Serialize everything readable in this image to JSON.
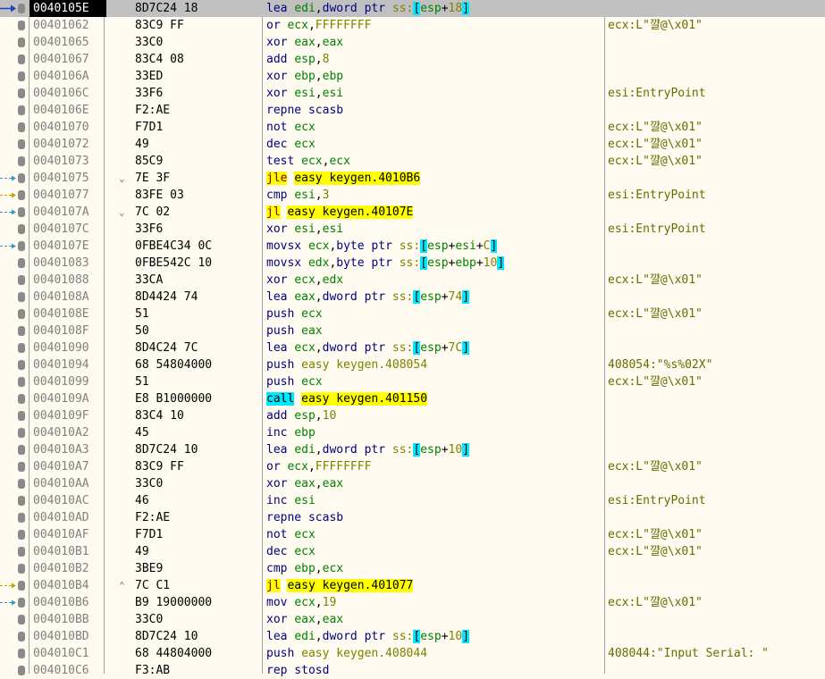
{
  "colors": {
    "background": "#fffbf0",
    "selected_row": "#c0c0c0",
    "address": "#808080",
    "mnemonic": "#000080",
    "register": "#008000",
    "number": "#808000",
    "jump_highlight": "#ffff00",
    "call_highlight": "#00e8ff",
    "comment": "#6b6b00",
    "jump_arrow": "#3399cc",
    "jump_arrow_dashed": "#c8a000"
  },
  "rows": [
    {
      "addr": "0040105E",
      "bytes": "8D7C24 18",
      "instr": [
        [
          "mn",
          "lea "
        ],
        [
          "reg",
          "edi"
        ],
        [
          "",
          ","
        ],
        [
          "kw",
          "dword ptr "
        ],
        [
          "seg",
          "ss:"
        ],
        [
          "br",
          "["
        ],
        [
          "reg",
          "esp"
        ],
        [
          "",
          "+"
        ],
        [
          "num",
          "18"
        ],
        [
          "br",
          "]"
        ]
      ],
      "comment": "",
      "selected": true,
      "arrow": "current"
    },
    {
      "addr": "00401062",
      "bytes": "83C9 FF",
      "instr": [
        [
          "mn",
          "or "
        ],
        [
          "reg",
          "ecx"
        ],
        [
          "",
          ","
        ],
        [
          "num",
          "FFFFFFFF"
        ]
      ],
      "comment": "ecx:L\"꺌@\\x01\""
    },
    {
      "addr": "00401065",
      "bytes": "33C0",
      "instr": [
        [
          "mn",
          "xor "
        ],
        [
          "reg",
          "eax"
        ],
        [
          "",
          ","
        ],
        [
          "reg",
          "eax"
        ]
      ],
      "comment": ""
    },
    {
      "addr": "00401067",
      "bytes": "83C4 08",
      "instr": [
        [
          "mn",
          "add "
        ],
        [
          "reg",
          "esp"
        ],
        [
          "",
          ","
        ],
        [
          "num",
          "8"
        ]
      ],
      "comment": ""
    },
    {
      "addr": "0040106A",
      "bytes": "33ED",
      "instr": [
        [
          "mn",
          "xor "
        ],
        [
          "reg",
          "ebp"
        ],
        [
          "",
          ","
        ],
        [
          "reg",
          "ebp"
        ]
      ],
      "comment": ""
    },
    {
      "addr": "0040106C",
      "bytes": "33F6",
      "instr": [
        [
          "mn",
          "xor "
        ],
        [
          "reg",
          "esi"
        ],
        [
          "",
          ","
        ],
        [
          "reg",
          "esi"
        ]
      ],
      "comment": "esi:EntryPoint"
    },
    {
      "addr": "0040106E",
      "bytes": "F2:AE",
      "instr": [
        [
          "mn",
          "repne scasb"
        ]
      ],
      "comment": ""
    },
    {
      "addr": "00401070",
      "bytes": "F7D1",
      "instr": [
        [
          "mn",
          "not "
        ],
        [
          "reg",
          "ecx"
        ]
      ],
      "comment": "ecx:L\"꺌@\\x01\""
    },
    {
      "addr": "00401072",
      "bytes": "49",
      "instr": [
        [
          "mn",
          "dec "
        ],
        [
          "reg",
          "ecx"
        ]
      ],
      "comment": "ecx:L\"꺌@\\x01\""
    },
    {
      "addr": "00401073",
      "bytes": "85C9",
      "instr": [
        [
          "mn",
          "test "
        ],
        [
          "reg",
          "ecx"
        ],
        [
          "",
          ","
        ],
        [
          "reg",
          "ecx"
        ]
      ],
      "comment": "ecx:L\"꺌@\\x01\""
    },
    {
      "addr": "00401075",
      "bytes": "7E 3F",
      "fold": "⌄",
      "instr": [
        [
          "jmp",
          "jle"
        ],
        [
          "",
          " "
        ],
        [
          "jmpsym",
          "easy keygen.4010B6"
        ]
      ],
      "comment": "",
      "arrow": "blue"
    },
    {
      "addr": "00401077",
      "bytes": "83FE 03",
      "instr": [
        [
          "mn",
          "cmp "
        ],
        [
          "reg",
          "esi"
        ],
        [
          "",
          ","
        ],
        [
          "num",
          "3"
        ]
      ],
      "comment": "esi:EntryPoint",
      "arrow": "gold"
    },
    {
      "addr": "0040107A",
      "bytes": "7C 02",
      "fold": "⌄",
      "instr": [
        [
          "jmp",
          "jl"
        ],
        [
          "",
          " "
        ],
        [
          "jmpsym",
          "easy keygen.40107E"
        ]
      ],
      "comment": "",
      "arrow": "blue"
    },
    {
      "addr": "0040107C",
      "bytes": "33F6",
      "instr": [
        [
          "mn",
          "xor "
        ],
        [
          "reg",
          "esi"
        ],
        [
          "",
          ","
        ],
        [
          "reg",
          "esi"
        ]
      ],
      "comment": "esi:EntryPoint"
    },
    {
      "addr": "0040107E",
      "bytes": "0FBE4C34 0C",
      "instr": [
        [
          "mn",
          "movsx "
        ],
        [
          "reg",
          "ecx"
        ],
        [
          "",
          ","
        ],
        [
          "kw",
          "byte ptr "
        ],
        [
          "seg",
          "ss:"
        ],
        [
          "br",
          "["
        ],
        [
          "reg",
          "esp"
        ],
        [
          "",
          "+"
        ],
        [
          "reg",
          "esi"
        ],
        [
          "",
          "+"
        ],
        [
          "num",
          "C"
        ],
        [
          "br",
          "]"
        ]
      ],
      "comment": "",
      "arrow": "blue"
    },
    {
      "addr": "00401083",
      "bytes": "0FBE542C 10",
      "instr": [
        [
          "mn",
          "movsx "
        ],
        [
          "reg",
          "edx"
        ],
        [
          "",
          ","
        ],
        [
          "kw",
          "byte ptr "
        ],
        [
          "seg",
          "ss:"
        ],
        [
          "br",
          "["
        ],
        [
          "reg",
          "esp"
        ],
        [
          "",
          "+"
        ],
        [
          "reg",
          "ebp"
        ],
        [
          "",
          "+"
        ],
        [
          "num",
          "10"
        ],
        [
          "br",
          "]"
        ]
      ],
      "comment": ""
    },
    {
      "addr": "00401088",
      "bytes": "33CA",
      "instr": [
        [
          "mn",
          "xor "
        ],
        [
          "reg",
          "ecx"
        ],
        [
          "",
          ","
        ],
        [
          "reg",
          "edx"
        ]
      ],
      "comment": "ecx:L\"꺌@\\x01\""
    },
    {
      "addr": "0040108A",
      "bytes": "8D4424 74",
      "instr": [
        [
          "mn",
          "lea "
        ],
        [
          "reg",
          "eax"
        ],
        [
          "",
          ","
        ],
        [
          "kw",
          "dword ptr "
        ],
        [
          "seg",
          "ss:"
        ],
        [
          "br",
          "["
        ],
        [
          "reg",
          "esp"
        ],
        [
          "",
          "+"
        ],
        [
          "num",
          "74"
        ],
        [
          "br",
          "]"
        ]
      ],
      "comment": ""
    },
    {
      "addr": "0040108E",
      "bytes": "51",
      "instr": [
        [
          "mn",
          "push "
        ],
        [
          "reg",
          "ecx"
        ]
      ],
      "comment": "ecx:L\"꺌@\\x01\""
    },
    {
      "addr": "0040108F",
      "bytes": "50",
      "instr": [
        [
          "mn",
          "push "
        ],
        [
          "reg",
          "eax"
        ]
      ],
      "comment": ""
    },
    {
      "addr": "00401090",
      "bytes": "8D4C24 7C",
      "instr": [
        [
          "mn",
          "lea "
        ],
        [
          "reg",
          "ecx"
        ],
        [
          "",
          ","
        ],
        [
          "kw",
          "dword ptr "
        ],
        [
          "seg",
          "ss:"
        ],
        [
          "br",
          "["
        ],
        [
          "reg",
          "esp"
        ],
        [
          "",
          "+"
        ],
        [
          "num",
          "7C"
        ],
        [
          "br",
          "]"
        ]
      ],
      "comment": ""
    },
    {
      "addr": "00401094",
      "bytes": "68 54804000",
      "instr": [
        [
          "mn",
          "push "
        ],
        [
          "sym",
          "easy keygen.408054"
        ]
      ],
      "comment": "408054:\"%s%02X\""
    },
    {
      "addr": "00401099",
      "bytes": "51",
      "instr": [
        [
          "mn",
          "push "
        ],
        [
          "reg",
          "ecx"
        ]
      ],
      "comment": "ecx:L\"꺌@\\x01\""
    },
    {
      "addr": "0040109A",
      "bytes": "E8 B1000000",
      "instr": [
        [
          "call",
          "call"
        ],
        [
          "",
          " "
        ],
        [
          "jmpsym",
          "easy keygen.401150"
        ]
      ],
      "comment": ""
    },
    {
      "addr": "0040109F",
      "bytes": "83C4 10",
      "instr": [
        [
          "mn",
          "add "
        ],
        [
          "reg",
          "esp"
        ],
        [
          "",
          ","
        ],
        [
          "num",
          "10"
        ]
      ],
      "comment": ""
    },
    {
      "addr": "004010A2",
      "bytes": "45",
      "instr": [
        [
          "mn",
          "inc "
        ],
        [
          "reg",
          "ebp"
        ]
      ],
      "comment": ""
    },
    {
      "addr": "004010A3",
      "bytes": "8D7C24 10",
      "instr": [
        [
          "mn",
          "lea "
        ],
        [
          "reg",
          "edi"
        ],
        [
          "",
          ","
        ],
        [
          "kw",
          "dword ptr "
        ],
        [
          "seg",
          "ss:"
        ],
        [
          "br",
          "["
        ],
        [
          "reg",
          "esp"
        ],
        [
          "",
          "+"
        ],
        [
          "num",
          "10"
        ],
        [
          "br",
          "]"
        ]
      ],
      "comment": ""
    },
    {
      "addr": "004010A7",
      "bytes": "83C9 FF",
      "instr": [
        [
          "mn",
          "or "
        ],
        [
          "reg",
          "ecx"
        ],
        [
          "",
          ","
        ],
        [
          "num",
          "FFFFFFFF"
        ]
      ],
      "comment": "ecx:L\"꺌@\\x01\""
    },
    {
      "addr": "004010AA",
      "bytes": "33C0",
      "instr": [
        [
          "mn",
          "xor "
        ],
        [
          "reg",
          "eax"
        ],
        [
          "",
          ","
        ],
        [
          "reg",
          "eax"
        ]
      ],
      "comment": ""
    },
    {
      "addr": "004010AC",
      "bytes": "46",
      "instr": [
        [
          "mn",
          "inc "
        ],
        [
          "reg",
          "esi"
        ]
      ],
      "comment": "esi:EntryPoint"
    },
    {
      "addr": "004010AD",
      "bytes": "F2:AE",
      "instr": [
        [
          "mn",
          "repne scasb"
        ]
      ],
      "comment": ""
    },
    {
      "addr": "004010AF",
      "bytes": "F7D1",
      "instr": [
        [
          "mn",
          "not "
        ],
        [
          "reg",
          "ecx"
        ]
      ],
      "comment": "ecx:L\"꺌@\\x01\""
    },
    {
      "addr": "004010B1",
      "bytes": "49",
      "instr": [
        [
          "mn",
          "dec "
        ],
        [
          "reg",
          "ecx"
        ]
      ],
      "comment": "ecx:L\"꺌@\\x01\""
    },
    {
      "addr": "004010B2",
      "bytes": "3BE9",
      "instr": [
        [
          "mn",
          "cmp "
        ],
        [
          "reg",
          "ebp"
        ],
        [
          "",
          ","
        ],
        [
          "reg",
          "ecx"
        ]
      ],
      "comment": ""
    },
    {
      "addr": "004010B4",
      "bytes": "7C C1",
      "fold": "⌃",
      "instr": [
        [
          "jmp",
          "jl"
        ],
        [
          "",
          " "
        ],
        [
          "jmpsym",
          "easy keygen.401077"
        ]
      ],
      "comment": "",
      "arrow": "gold"
    },
    {
      "addr": "004010B6",
      "bytes": "B9 19000000",
      "instr": [
        [
          "mn",
          "mov "
        ],
        [
          "reg",
          "ecx"
        ],
        [
          "",
          ","
        ],
        [
          "num",
          "19"
        ]
      ],
      "comment": "ecx:L\"꺌@\\x01\"",
      "arrow": "blue"
    },
    {
      "addr": "004010BB",
      "bytes": "33C0",
      "instr": [
        [
          "mn",
          "xor "
        ],
        [
          "reg",
          "eax"
        ],
        [
          "",
          ","
        ],
        [
          "reg",
          "eax"
        ]
      ],
      "comment": ""
    },
    {
      "addr": "004010BD",
      "bytes": "8D7C24 10",
      "instr": [
        [
          "mn",
          "lea "
        ],
        [
          "reg",
          "edi"
        ],
        [
          "",
          ","
        ],
        [
          "kw",
          "dword ptr "
        ],
        [
          "seg",
          "ss:"
        ],
        [
          "br",
          "["
        ],
        [
          "reg",
          "esp"
        ],
        [
          "",
          "+"
        ],
        [
          "num",
          "10"
        ],
        [
          "br",
          "]"
        ]
      ],
      "comment": ""
    },
    {
      "addr": "004010C1",
      "bytes": "68 44804000",
      "instr": [
        [
          "mn",
          "push "
        ],
        [
          "sym",
          "easy keygen.408044"
        ]
      ],
      "comment": "408044:\"Input Serial: \""
    },
    {
      "addr": "004010C6",
      "bytes": "F3:AB",
      "instr": [
        [
          "mn",
          "rep stosd"
        ]
      ],
      "comment": ""
    }
  ]
}
